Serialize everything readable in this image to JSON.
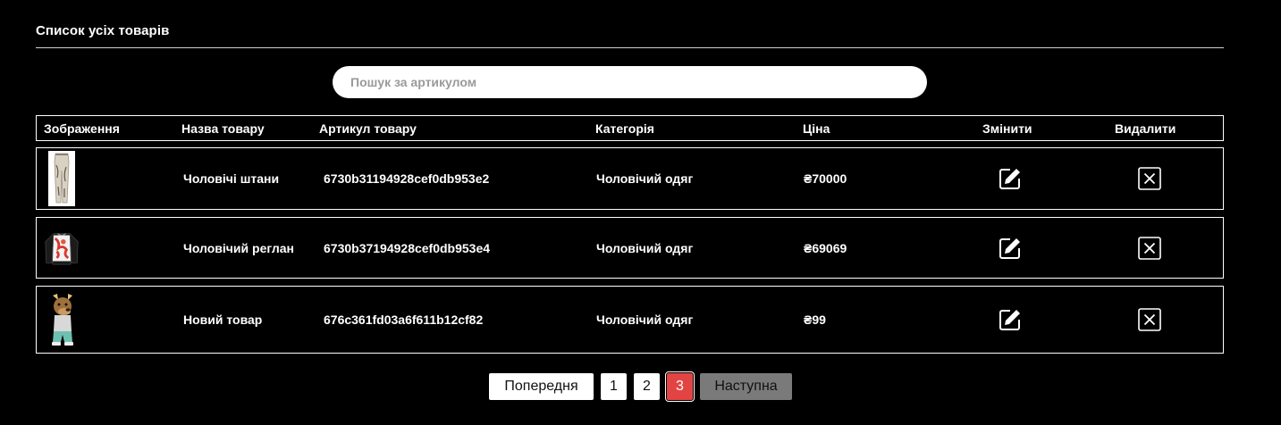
{
  "page": {
    "title": "Список усіх товарів"
  },
  "search": {
    "placeholder": "Пошук за артикулом",
    "value": ""
  },
  "table": {
    "columns": {
      "image": "Зображення",
      "name": "Назва товару",
      "sku": "Артикул товару",
      "category": "Категорія",
      "price": "Ціна",
      "edit": "Змінити",
      "delete": "Видалити"
    },
    "rows": [
      {
        "image_icon": "pants-thumbnail",
        "name": "Чоловічі штани",
        "sku": "6730b31194928cef0db953e2",
        "category": "Чоловічий одяг",
        "price": "₴70000",
        "edit_icon": "edit-icon",
        "delete_icon": "close-box-icon"
      },
      {
        "image_icon": "sweatshirt-thumbnail",
        "name": "Чоловічий реглан",
        "sku": "6730b37194928cef0db953e4",
        "category": "Чоловічий одяг",
        "price": "₴69069",
        "edit_icon": "edit-icon",
        "delete_icon": "close-box-icon"
      },
      {
        "image_icon": "dog-character-thumbnail",
        "name": "Новий товар",
        "sku": "676c361fd03a6f611b12cf82",
        "category": "Чоловічий одяг",
        "price": "₴99",
        "edit_icon": "edit-icon",
        "delete_icon": "close-box-icon"
      }
    ]
  },
  "pagination": {
    "prev": "Попередня",
    "pages": [
      "1",
      "2",
      "3"
    ],
    "current": "3",
    "next": "Наступна"
  },
  "colors": {
    "background": "#000000",
    "active_page": "#e24444",
    "disabled_button": "#7a7a7a"
  }
}
